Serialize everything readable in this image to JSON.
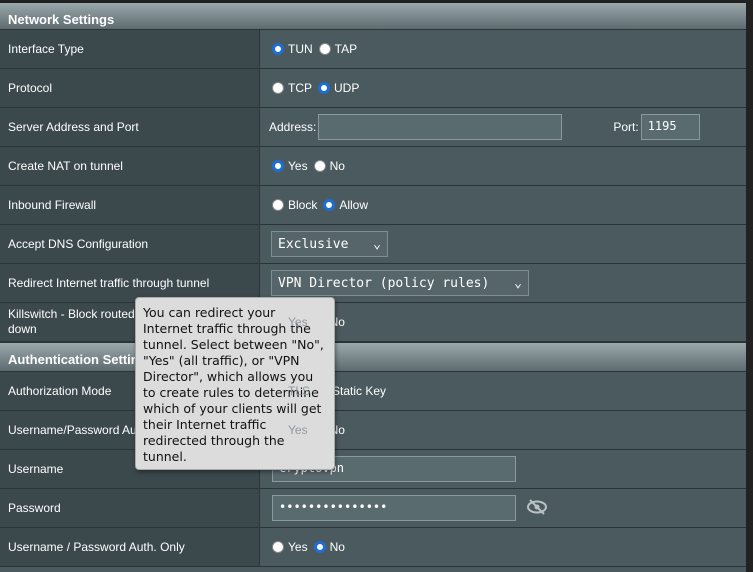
{
  "network": {
    "title": "Network Settings",
    "interface_type": {
      "label": "Interface Type",
      "options": [
        "TUN",
        "TAP"
      ],
      "selected": "TUN"
    },
    "protocol": {
      "label": "Protocol",
      "options": [
        "TCP",
        "UDP"
      ],
      "selected": "UDP"
    },
    "server": {
      "label": "Server Address and Port",
      "address_label": "Address:",
      "address_value": "",
      "port_label": "Port:",
      "port_value": "1195"
    },
    "nat": {
      "label": "Create NAT on tunnel",
      "options": [
        "Yes",
        "No"
      ],
      "selected": "Yes"
    },
    "firewall": {
      "label": "Inbound Firewall",
      "options": [
        "Block",
        "Allow"
      ],
      "selected": "Allow"
    },
    "dns": {
      "label": "Accept DNS Configuration",
      "value": "Exclusive"
    },
    "redirect": {
      "label": "Redirect Internet traffic through tunnel",
      "value": "VPN Director (policy rules)"
    },
    "killswitch": {
      "label": "Killswitch - Block routed clients if tunnel goes down",
      "options": [
        "Yes",
        "No"
      ]
    }
  },
  "auth": {
    "title": "Authentication Settings",
    "mode": {
      "label": "Authorization Mode",
      "options": [
        "TLS",
        "Static Key"
      ]
    },
    "upa": {
      "label": "Username/Password Authentication",
      "options": [
        "Yes",
        "No"
      ]
    },
    "username": {
      "label": "Username",
      "value": "cryptovpn"
    },
    "password": {
      "label": "Password",
      "value": "•••••••••••••••"
    },
    "only": {
      "label": "Username / Password Auth. Only",
      "options": [
        "Yes",
        "No"
      ],
      "selected": "No"
    }
  },
  "tooltip": "You can redirect your Internet traffic through the tunnel. Select between \"No\", \"Yes\" (all traffic), or \"VPN Director\", which allows you to create rules to determine which of your clients will get their Internet traffic redirected through the tunnel.",
  "colors": {
    "accent": "#1c6ed4",
    "label_bg": "#3b484c",
    "value_bg": "#4b5a5f"
  }
}
